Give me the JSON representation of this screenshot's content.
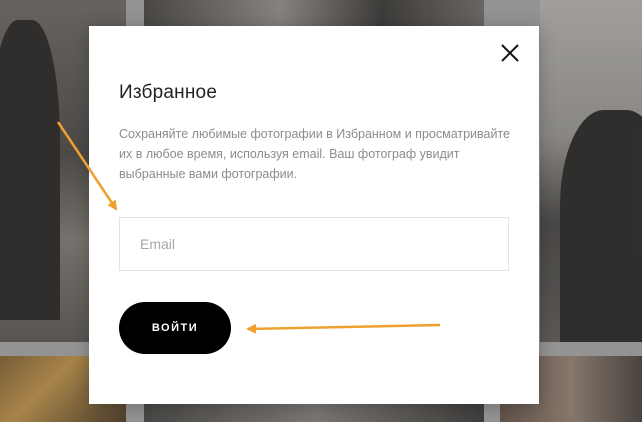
{
  "modal": {
    "title": "Избранное",
    "description": "Сохраняйте любимые фотографии в Избранном и просматривайте их в любое время, используя email. Ваш фотограф увидит выбранные вами фотографии.",
    "email_placeholder": "Email",
    "email_value": "",
    "login_label": "ВОЙТИ",
    "close_icon": "close-icon"
  },
  "annotations": {
    "arrow_color": "#f0a030"
  },
  "colors": {
    "button_bg": "#000000",
    "button_text": "#ffffff",
    "title_text": "#222222",
    "description_text": "#8c8c8c"
  }
}
